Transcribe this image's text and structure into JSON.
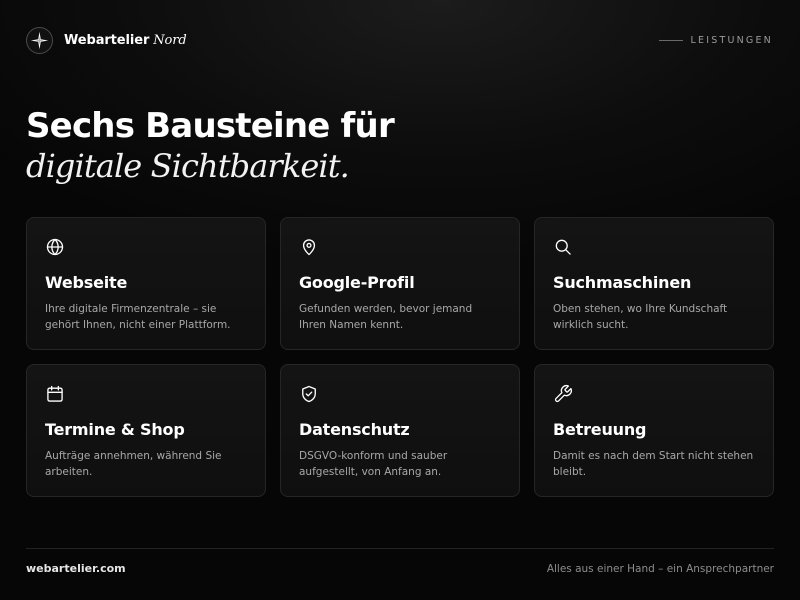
{
  "header": {
    "brand_name": "Webartelier",
    "brand_accent": "Nord",
    "logo_icon": "compass-star-icon",
    "section_label": "LEISTUNGEN"
  },
  "hero": {
    "line1": "Sechs Bausteine für",
    "line2": "digitale Sichtbarkeit."
  },
  "cards": [
    {
      "icon": "globe-icon",
      "title": "Webseite",
      "description": "Ihre digitale Firmenzentrale – sie gehört Ihnen, nicht einer Plattform."
    },
    {
      "icon": "map-pin-icon",
      "title": "Google-Profil",
      "description": "Gefunden werden, bevor jemand Ihren Namen kennt."
    },
    {
      "icon": "search-icon",
      "title": "Suchmaschinen",
      "description": "Oben stehen, wo Ihre Kundschaft wirklich sucht."
    },
    {
      "icon": "calendar-icon",
      "title": "Termine & Shop",
      "description": "Aufträge annehmen, während Sie arbeiten."
    },
    {
      "icon": "shield-check-icon",
      "title": "Datenschutz",
      "description": "DSGVO-konform und sauber aufgestellt, von Anfang an."
    },
    {
      "icon": "wrench-icon",
      "title": "Betreuung",
      "description": "Damit es nach dem Start nicht stehen bleibt."
    }
  ],
  "footer": {
    "domain": "webartelier.com",
    "tagline": "Alles aus einer Hand – ein Ansprechpartner"
  },
  "colors": {
    "background": "#070707",
    "card_border": "#262626",
    "text_primary": "#ffffff",
    "text_secondary": "#a8a8a8"
  }
}
